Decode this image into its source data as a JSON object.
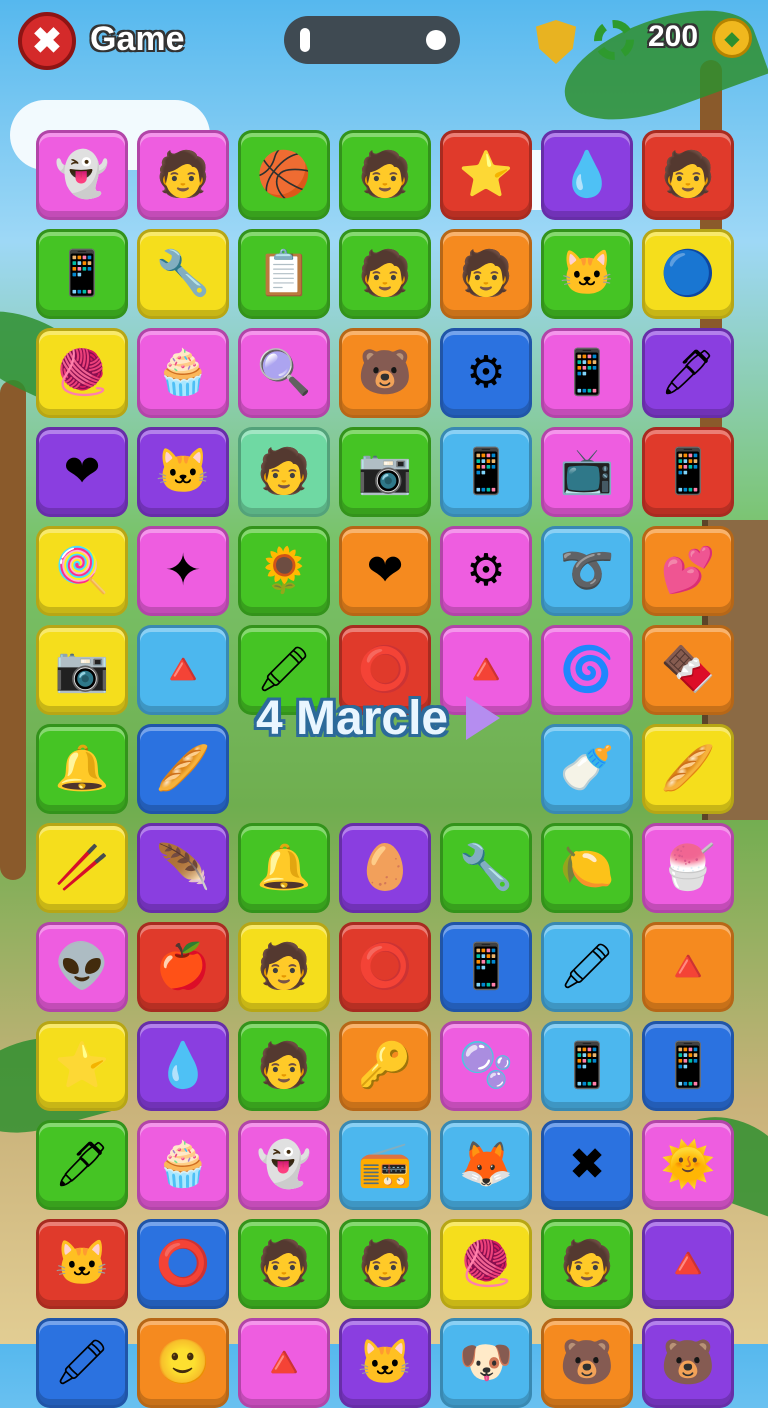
{
  "header": {
    "close_icon": "✖",
    "title": "Game",
    "coins": "200",
    "coin_icon": "◆"
  },
  "banner": {
    "text": "4 Marcle"
  },
  "colors": {
    "pink": "#ee5de0",
    "green": "#45c424",
    "red": "#e03a2b",
    "purple": "#8a3ee0",
    "yellow": "#f5de1c",
    "orange": "#f58a1f",
    "blue": "#2b72e0",
    "lightblue": "#4cb7ee",
    "mint": "#6fd9a3"
  },
  "board": {
    "rows": [
      [
        [
          "pink",
          "👻"
        ],
        [
          "pink",
          "🧑"
        ],
        [
          "green",
          "🏀"
        ],
        [
          "green",
          "🧑"
        ],
        [
          "red",
          "⭐"
        ],
        [
          "purple",
          "💧"
        ],
        [
          "red",
          "🧑"
        ]
      ],
      [
        [
          "green",
          "📱"
        ],
        [
          "yellow",
          "🔧"
        ],
        [
          "green",
          "📋"
        ],
        [
          "green",
          "🧑"
        ],
        [
          "orange",
          "🧑"
        ],
        [
          "green",
          "🐱"
        ],
        [
          "yellow",
          "🔵"
        ]
      ],
      [
        [
          "yellow",
          "🧶"
        ],
        [
          "pink",
          "🧁"
        ],
        [
          "pink",
          "🔍"
        ],
        [
          "orange",
          "🐻"
        ],
        [
          "blue",
          "⚙"
        ],
        [
          "pink",
          "📱"
        ],
        [
          "purple",
          "🖊"
        ]
      ],
      [
        [
          "purple",
          "❤"
        ],
        [
          "purple",
          "🐱"
        ],
        [
          "mint",
          "🧑"
        ],
        [
          "green",
          "📷"
        ],
        [
          "lightblue",
          "📱"
        ],
        [
          "pink",
          "📺"
        ],
        [
          "red",
          "📱"
        ]
      ],
      [
        [
          "yellow",
          "🍭"
        ],
        [
          "pink",
          "✦"
        ],
        [
          "green",
          "🌻"
        ],
        [
          "orange",
          "❤"
        ],
        [
          "pink",
          "⚙"
        ],
        [
          "lightblue",
          "➰"
        ],
        [
          "orange",
          "💕"
        ]
      ],
      [
        [
          "yellow",
          "📷"
        ],
        [
          "lightblue",
          "🔺"
        ],
        [
          "green",
          "🖍"
        ],
        [
          "red",
          "⭕"
        ],
        [
          "pink",
          "🔺"
        ],
        [
          "pink",
          "🌀"
        ],
        [
          "orange",
          "🍫"
        ]
      ],
      [
        [
          "green",
          "🔔"
        ],
        [
          "blue",
          "🥖"
        ],
        [
          "",
          ""
        ],
        [
          "",
          ""
        ],
        [
          "",
          ""
        ],
        [
          "lightblue",
          "🍼"
        ],
        [
          "yellow",
          "🥖"
        ]
      ],
      [
        [
          "yellow",
          "🥢"
        ],
        [
          "purple",
          "🪶"
        ],
        [
          "green",
          "🔔"
        ],
        [
          "purple",
          "🥚"
        ],
        [
          "green",
          "🔧"
        ],
        [
          "green",
          "🍋"
        ],
        [
          "pink",
          "🍧"
        ]
      ],
      [
        [
          "pink",
          "👽"
        ],
        [
          "red",
          "🍎"
        ],
        [
          "yellow",
          "🧑"
        ],
        [
          "red",
          "⭕"
        ],
        [
          "blue",
          "📱"
        ],
        [
          "lightblue",
          "🖍"
        ],
        [
          "orange",
          "🔺"
        ]
      ],
      [
        [
          "yellow",
          "⭐"
        ],
        [
          "purple",
          "💧"
        ],
        [
          "green",
          "🧑"
        ],
        [
          "orange",
          "🔑"
        ],
        [
          "pink",
          "🫧"
        ],
        [
          "lightblue",
          "📱"
        ],
        [
          "blue",
          "📱"
        ]
      ],
      [
        [
          "green",
          "🖊"
        ],
        [
          "pink",
          "🧁"
        ],
        [
          "pink",
          "👻"
        ],
        [
          "lightblue",
          "📻"
        ],
        [
          "lightblue",
          "🦊"
        ],
        [
          "blue",
          "✖"
        ],
        [
          "pink",
          "🌞"
        ]
      ],
      [
        [
          "red",
          "🐱"
        ],
        [
          "blue",
          "⭕"
        ],
        [
          "green",
          "🧑"
        ],
        [
          "green",
          "🧑"
        ],
        [
          "yellow",
          "🧶"
        ],
        [
          "green",
          "🧑"
        ],
        [
          "purple",
          "🔺"
        ]
      ],
      [
        [
          "blue",
          "🖍"
        ],
        [
          "orange",
          "🙂"
        ],
        [
          "pink",
          "🔺"
        ],
        [
          "purple",
          "🐱"
        ],
        [
          "lightblue",
          "🐶"
        ],
        [
          "orange",
          "🐻"
        ],
        [
          "purple",
          "🐻"
        ]
      ]
    ]
  }
}
